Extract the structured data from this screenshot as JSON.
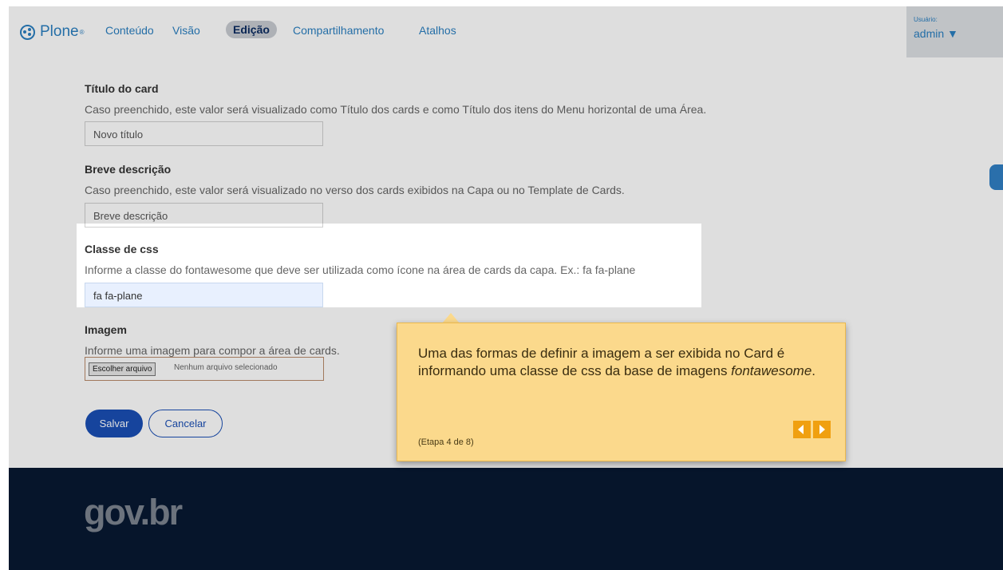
{
  "toolbar": {
    "logo": "Plone",
    "logo_mark": "®",
    "nav": [
      "Conteúdo",
      "Visão",
      "Edição",
      "Compartilhamento",
      "Atalhos"
    ],
    "active_nav": "Edição",
    "user_label": "Usuário:",
    "user_name": "admin ▼"
  },
  "form": {
    "title_label": "Título do card",
    "title_help": "Caso preenchido, este valor será visualizado como Título dos cards e como Título dos itens do Menu horizontal de uma Área.",
    "title_value": "Novo título",
    "desc_label": "Breve descrição",
    "desc_help": "Caso preenchido, este valor será visualizado no verso dos cards exibidos na Capa ou no Template de Cards.",
    "desc_value": "Breve descrição",
    "css_label": "Classe de css",
    "css_help": "Informe a classe do fontawesome que deve ser utilizada como ícone na área de cards da capa. Ex.: fa fa-plane",
    "css_value": "fa fa-plane",
    "image_label": "Imagem",
    "image_help": "Informe uma imagem para compor a área de cards.",
    "file_button": "Escolher arquivo",
    "file_status": "Nenhum arquivo selecionado",
    "save": "Salvar",
    "cancel": "Cancelar"
  },
  "tooltip": {
    "text_before": "Uma das formas de definir a imagem a ser exibida no Card é informando uma classe de css da base de imagens ",
    "text_em": "fontawesome",
    "text_after": ".",
    "step": "(Etapa 4 de 8)",
    "accent_color": "#f0a010"
  },
  "footer": {
    "logo": "gov.br"
  },
  "colors": {
    "overlay": "rgba(0,0,0,0.13)",
    "footer_bg": "#081932",
    "primary": "#1a4fb5"
  }
}
